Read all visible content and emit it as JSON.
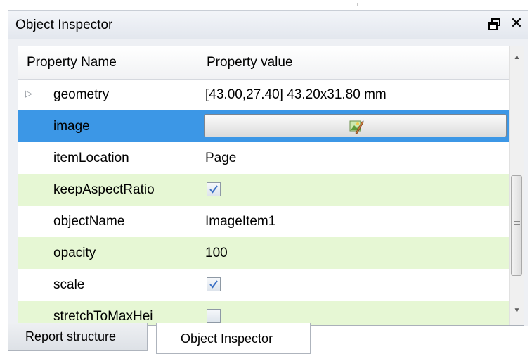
{
  "window": {
    "title": "Object Inspector",
    "float_icon": "float-window-icon",
    "close_glyph": "✕"
  },
  "table": {
    "columns": [
      "Property Name",
      "Property value"
    ],
    "rows": [
      {
        "name": "geometry",
        "value": "[43.00,27.40] 43.20x31.80 mm",
        "expandable": true,
        "kind": "text"
      },
      {
        "name": "image",
        "value": "",
        "kind": "image-button",
        "selected": true,
        "icon": "image-editor-icon"
      },
      {
        "name": "itemLocation",
        "value": "Page",
        "kind": "text"
      },
      {
        "name": "keepAspectRatio",
        "value": "",
        "kind": "checkbox",
        "checked": true
      },
      {
        "name": "objectName",
        "value": "ImageItem1",
        "kind": "text"
      },
      {
        "name": "opacity",
        "value": "100",
        "kind": "text"
      },
      {
        "name": "scale",
        "value": "",
        "kind": "checkbox",
        "checked": true
      },
      {
        "name": "stretchToMaxHei",
        "value": "",
        "kind": "checkbox",
        "checked": false
      }
    ]
  },
  "tabs": [
    {
      "label": "Report structure",
      "active": false
    },
    {
      "label": "Object Inspector",
      "active": true
    }
  ],
  "colors": {
    "selection": "#3c97e6",
    "alt_row": "#e6f7d4",
    "checkmark": "#3a6fc4"
  }
}
